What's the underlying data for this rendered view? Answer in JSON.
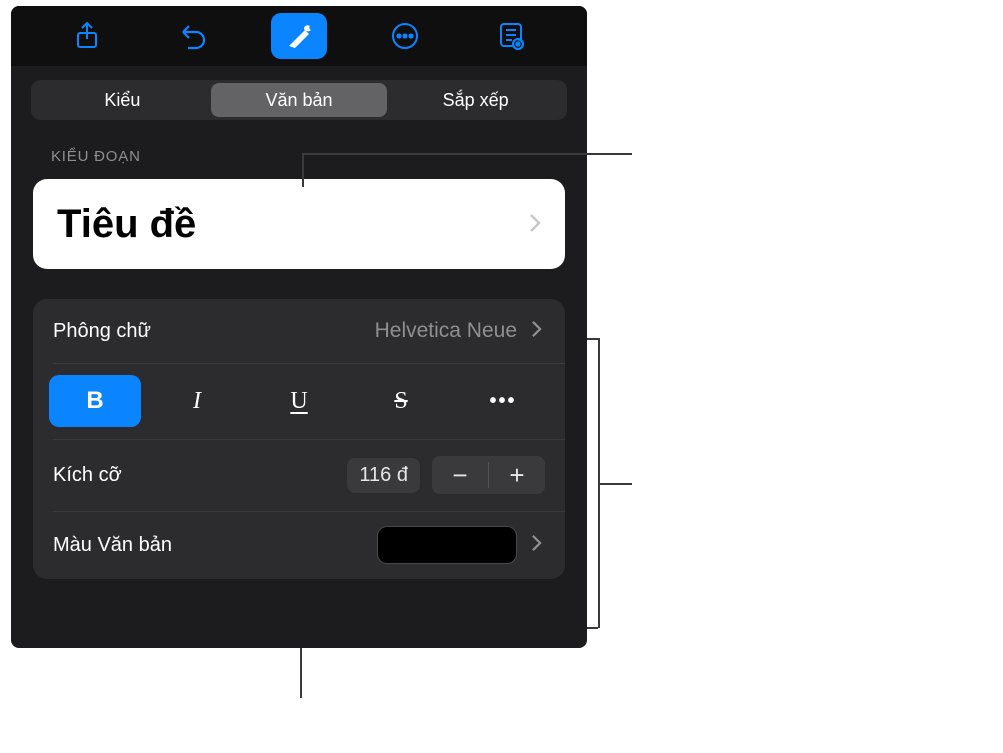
{
  "tabs": {
    "style": "Kiểu",
    "text": "Văn bản",
    "arrange": "Sắp xếp"
  },
  "section_label": "KIỂU ĐOẠN",
  "paragraph_style": "Tiêu đề",
  "font": {
    "label": "Phông chữ",
    "value": "Helvetica Neue"
  },
  "style_buttons": {
    "bold": "B",
    "italic": "I",
    "underline": "U",
    "strike": "S",
    "more": "•••"
  },
  "size": {
    "label": "Kích cỡ",
    "value": "116 đ",
    "minus": "−",
    "plus": "+"
  },
  "text_color": {
    "label": "Màu Văn bản",
    "value": "#000000"
  }
}
